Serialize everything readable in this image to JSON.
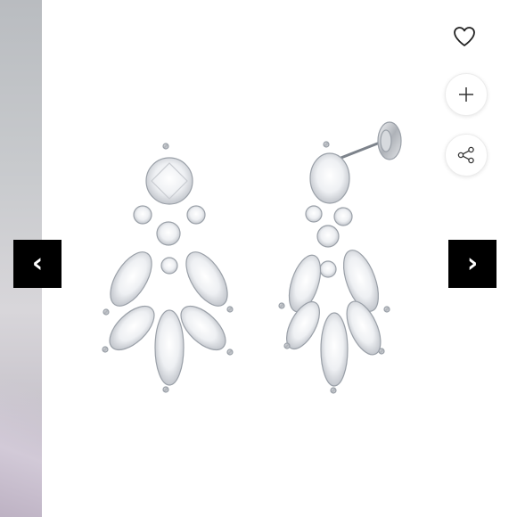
{
  "gallery": {
    "prev_label": "‹",
    "next_label": "›",
    "actions": [
      "wishlist",
      "zoom",
      "share"
    ],
    "icons": {
      "wishlist": "heart-icon",
      "zoom": "plus-icon",
      "share": "share-icon",
      "prev": "chevron-left-icon",
      "next": "chevron-right-icon"
    }
  },
  "colors": {
    "arrow_bg": "#000000",
    "arrow_fg": "#ffffff",
    "page_bg": "#ffffff",
    "icon": "#222222"
  }
}
